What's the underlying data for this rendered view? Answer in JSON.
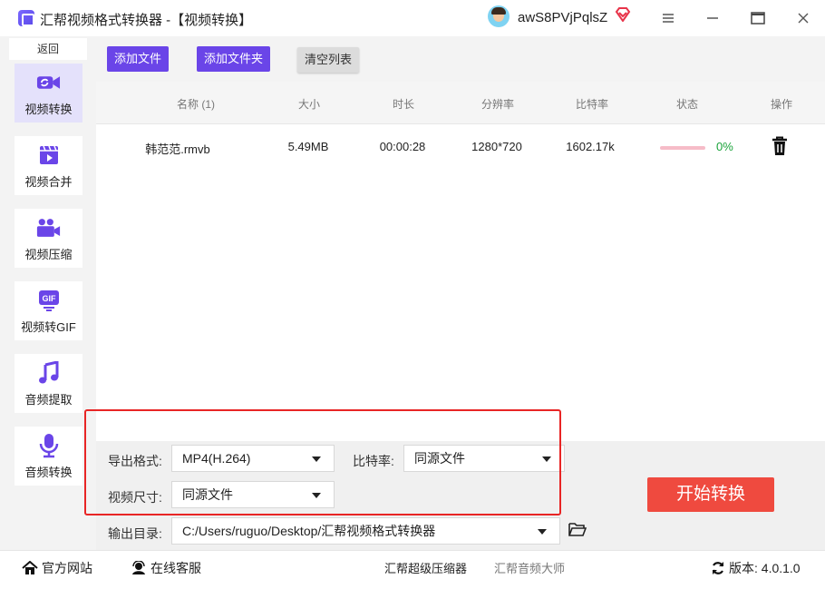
{
  "titlebar": {
    "app_title": "汇帮视频格式转换器  -【视频转换】",
    "username": "awS8PVjPqlsZ"
  },
  "sidebar": {
    "back_label": "返回",
    "items": [
      {
        "label": "视频转换",
        "icon": "video-convert-icon",
        "active": true
      },
      {
        "label": "视频合并",
        "icon": "film-clip-icon",
        "active": false
      },
      {
        "label": "视频压缩",
        "icon": "camera-compress-icon",
        "active": false
      },
      {
        "label": "视频转GIF",
        "icon": "gif-icon",
        "active": false
      },
      {
        "label": "音频提取",
        "icon": "music-note-icon",
        "active": false
      },
      {
        "label": "音频转换",
        "icon": "microphone-icon",
        "active": false
      }
    ]
  },
  "toolbar": {
    "add_file": "添加文件",
    "add_folder": "添加文件夹",
    "clear_list": "清空列表"
  },
  "table": {
    "headers": {
      "name": "名称 (1)",
      "size": "大小",
      "duration": "时长",
      "resolution": "分辨率",
      "bitrate": "比特率",
      "status": "状态",
      "action": "操作"
    },
    "rows": [
      {
        "name": "韩范范.rmvb",
        "size": "5.49MB",
        "duration": "00:00:28",
        "resolution": "1280*720",
        "bitrate": "1602.17k",
        "progress": 0,
        "progress_label": "0%"
      }
    ]
  },
  "settings": {
    "format_label": "导出格式:",
    "format_value": "MP4(H.264)",
    "bitrate_label": "比特率:",
    "bitrate_value": "同源文件",
    "size_label": "视频尺寸:",
    "size_value": "同源文件",
    "output_label": "输出目录:",
    "output_value": "C:/Users/ruguo/Desktop/汇帮视频格式转换器",
    "start_button": "开始转换"
  },
  "footer": {
    "website": "官方网站",
    "support": "在线客服",
    "link1": "汇帮超级压缩器",
    "link2": "汇帮音频大师",
    "version": "版本: 4.0.1.0"
  },
  "colors": {
    "accent": "#6a45e8",
    "start": "#ef4a3f",
    "highlight_box": "#e82525",
    "progress_text": "#1aa33a"
  }
}
